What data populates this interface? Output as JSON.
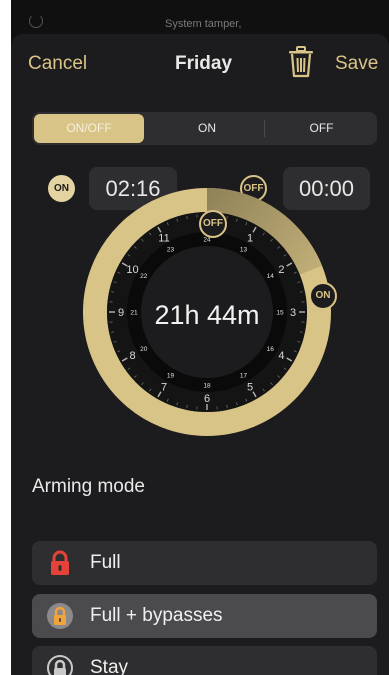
{
  "background_notification": {
    "text": "System tamper,"
  },
  "nav": {
    "cancel": "Cancel",
    "title": "Friday",
    "trash_icon": "trash-icon",
    "save": "Save"
  },
  "segments": {
    "selected": "ON/OFF",
    "items": [
      "ON/OFF",
      "ON",
      "OFF"
    ]
  },
  "schedule": {
    "on_badge": "ON",
    "on_time": "02:16",
    "off_badge": "OFF",
    "off_time": "00:00",
    "duration": "21h 44m",
    "dial_on_marker": "ON",
    "dial_off_marker": "OFF",
    "outer_hours": [
      "12",
      "1",
      "2",
      "3",
      "4",
      "5",
      "6",
      "7",
      "8",
      "9",
      "10",
      "11"
    ],
    "inner_hours": [
      "24",
      "13",
      "14",
      "15",
      "16",
      "17",
      "18",
      "19",
      "20",
      "21",
      "22",
      "23"
    ],
    "active_color": "#d9c487"
  },
  "arming": {
    "title": "Arming mode",
    "selected": "Full + bypasses",
    "modes": [
      {
        "label": "Full",
        "icon": "lock-closed-icon",
        "icon_color": "#e5433a"
      },
      {
        "label": "Full + bypasses",
        "icon": "lock-bypass-icon",
        "icon_color": "#f2a33a"
      },
      {
        "label": "Stay",
        "icon": "lock-stay-icon",
        "icon_color": "#c9c9c9"
      }
    ]
  }
}
